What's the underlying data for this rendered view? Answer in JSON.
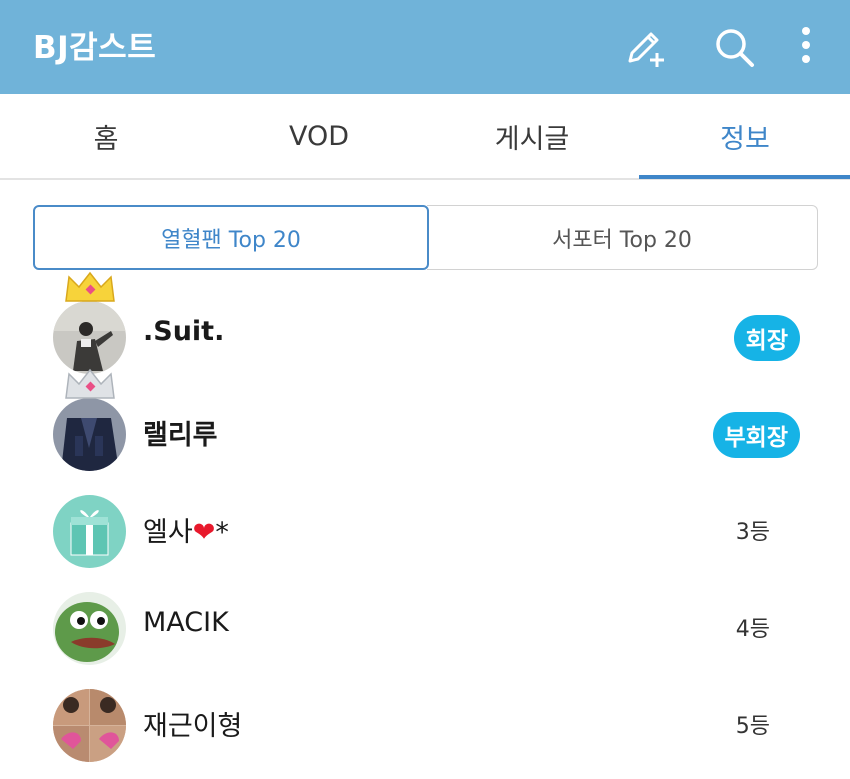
{
  "header": {
    "title": "BJ감스트",
    "icons": [
      "compose-plus-icon",
      "search-icon",
      "more-vertical-icon"
    ]
  },
  "tabs": [
    {
      "label": "홈",
      "active": false
    },
    {
      "label": "VOD",
      "active": false
    },
    {
      "label": "게시글",
      "active": false
    },
    {
      "label": "정보",
      "active": true
    }
  ],
  "segment": {
    "left_label": "열혈팬 Top 20",
    "right_label": "서포터 Top 20",
    "selected": "left"
  },
  "fans": [
    {
      "name": ".Suit.",
      "badge": "회장",
      "crown": "gold"
    },
    {
      "name": "랠리루",
      "badge": "부회장",
      "crown": "silver"
    },
    {
      "name": "엘사",
      "name_suffix": "*",
      "heart": "❤",
      "rank": "3등"
    },
    {
      "name": "MACIK",
      "rank": "4등"
    },
    {
      "name": "재근이형",
      "rank": "5등"
    }
  ],
  "colors": {
    "appbar": "#70b3d9",
    "accent": "#3f86c9",
    "badge": "#16b3e6",
    "heart": "#e8192c"
  }
}
